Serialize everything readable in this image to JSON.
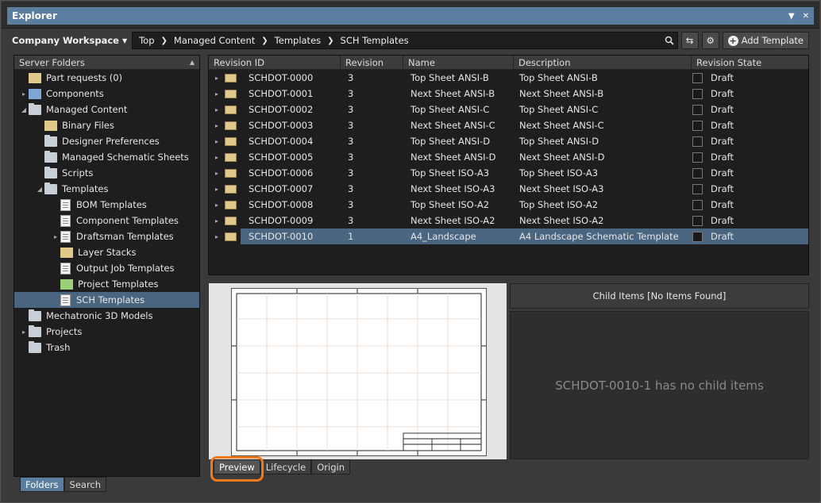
{
  "window": {
    "title": "Explorer"
  },
  "toolbar": {
    "workspace": "Company Workspace",
    "breadcrumbs": [
      "Top",
      "Managed Content",
      "Templates",
      "SCH Templates"
    ],
    "add_template_label": "Add Template"
  },
  "left_panel": {
    "header": "Server Folders",
    "items": [
      {
        "label": "Part requests (0)",
        "level": 0,
        "expander": "",
        "icon": "part-request-icon",
        "selected": false
      },
      {
        "label": "Components",
        "level": 0,
        "expander": "▸",
        "icon": "components-icon",
        "selected": false
      },
      {
        "label": "Managed Content",
        "level": 0,
        "expander": "◢",
        "icon": "folder-icon",
        "selected": false
      },
      {
        "label": "Binary Files",
        "level": 1,
        "expander": "",
        "icon": "binary-folder-icon",
        "selected": false
      },
      {
        "label": "Designer Preferences",
        "level": 1,
        "expander": "",
        "icon": "preferences-folder-icon",
        "selected": false
      },
      {
        "label": "Managed Schematic Sheets",
        "level": 1,
        "expander": "",
        "icon": "schematic-folder-icon",
        "selected": false
      },
      {
        "label": "Scripts",
        "level": 1,
        "expander": "",
        "icon": "scripts-folder-icon",
        "selected": false
      },
      {
        "label": "Templates",
        "level": 1,
        "expander": "◢",
        "icon": "folder-icon",
        "selected": false
      },
      {
        "label": "BOM Templates",
        "level": 2,
        "expander": "",
        "icon": "bom-template-icon",
        "selected": false
      },
      {
        "label": "Component Templates",
        "level": 2,
        "expander": "",
        "icon": "component-template-icon",
        "selected": false
      },
      {
        "label": "Draftsman Templates",
        "level": 2,
        "expander": "▸",
        "icon": "draftsman-template-icon",
        "selected": false
      },
      {
        "label": "Layer Stacks",
        "level": 2,
        "expander": "",
        "icon": "layer-stack-icon",
        "selected": false
      },
      {
        "label": "Output Job Templates",
        "level": 2,
        "expander": "",
        "icon": "output-job-icon",
        "selected": false
      },
      {
        "label": "Project Templates",
        "level": 2,
        "expander": "",
        "icon": "project-template-icon",
        "selected": false
      },
      {
        "label": "SCH Templates",
        "level": 2,
        "expander": "",
        "icon": "sch-template-icon",
        "selected": true
      },
      {
        "label": "Mechatronic 3D Models",
        "level": 0,
        "expander": "",
        "icon": "folder-icon",
        "selected": false
      },
      {
        "label": "Projects",
        "level": 0,
        "expander": "▸",
        "icon": "folder-icon",
        "selected": false
      },
      {
        "label": "Trash",
        "level": 0,
        "expander": "",
        "icon": "folder-icon",
        "selected": false
      }
    ],
    "tabs": [
      {
        "label": "Folders",
        "active": true
      },
      {
        "label": "Search",
        "active": false
      }
    ]
  },
  "grid": {
    "columns": [
      "Revision ID",
      "Revision",
      "Name",
      "Description",
      "Revision State"
    ],
    "rows": [
      {
        "id": "SCHDOT-0000",
        "rev": "3",
        "name": "Top Sheet ANSI-B",
        "desc": "Top Sheet ANSI-B",
        "state": "Draft",
        "selected": false
      },
      {
        "id": "SCHDOT-0001",
        "rev": "3",
        "name": "Next Sheet ANSI-B",
        "desc": "Next Sheet ANSI-B",
        "state": "Draft",
        "selected": false
      },
      {
        "id": "SCHDOT-0002",
        "rev": "3",
        "name": "Top Sheet ANSI-C",
        "desc": "Top Sheet ANSI-C",
        "state": "Draft",
        "selected": false
      },
      {
        "id": "SCHDOT-0003",
        "rev": "3",
        "name": "Next Sheet ANSI-C",
        "desc": "Next Sheet ANSI-C",
        "state": "Draft",
        "selected": false
      },
      {
        "id": "SCHDOT-0004",
        "rev": "3",
        "name": "Top Sheet ANSI-D",
        "desc": "Top Sheet ANSI-D",
        "state": "Draft",
        "selected": false
      },
      {
        "id": "SCHDOT-0005",
        "rev": "3",
        "name": "Next Sheet ANSI-D",
        "desc": "Next Sheet ANSI-D",
        "state": "Draft",
        "selected": false
      },
      {
        "id": "SCHDOT-0006",
        "rev": "3",
        "name": "Top Sheet ISO-A3",
        "desc": "Top Sheet ISO-A3",
        "state": "Draft",
        "selected": false
      },
      {
        "id": "SCHDOT-0007",
        "rev": "3",
        "name": "Next Sheet ISO-A3",
        "desc": "Next Sheet ISO-A3",
        "state": "Draft",
        "selected": false
      },
      {
        "id": "SCHDOT-0008",
        "rev": "3",
        "name": "Top Sheet ISO-A2",
        "desc": "Top Sheet ISO-A2",
        "state": "Draft",
        "selected": false
      },
      {
        "id": "SCHDOT-0009",
        "rev": "3",
        "name": "Next Sheet ISO-A2",
        "desc": "Next Sheet ISO-A2",
        "state": "Draft",
        "selected": false
      },
      {
        "id": "SCHDOT-0010",
        "rev": "1",
        "name": "A4_Landscape",
        "desc": "A4 Landscape Schematic Template",
        "state": "Draft",
        "selected": true
      }
    ]
  },
  "preview_tabs": [
    {
      "label": "Preview",
      "active": true
    },
    {
      "label": "Lifecycle",
      "active": false
    },
    {
      "label": "Origin",
      "active": false
    }
  ],
  "child_items": {
    "header": "Child Items [No Items Found]",
    "empty_message": "SCHDOT-0010-1 has no child items"
  },
  "colors": {
    "selection": "#4a6580",
    "title_bar": "#5b7e9e",
    "highlight": "#f07a1b"
  }
}
